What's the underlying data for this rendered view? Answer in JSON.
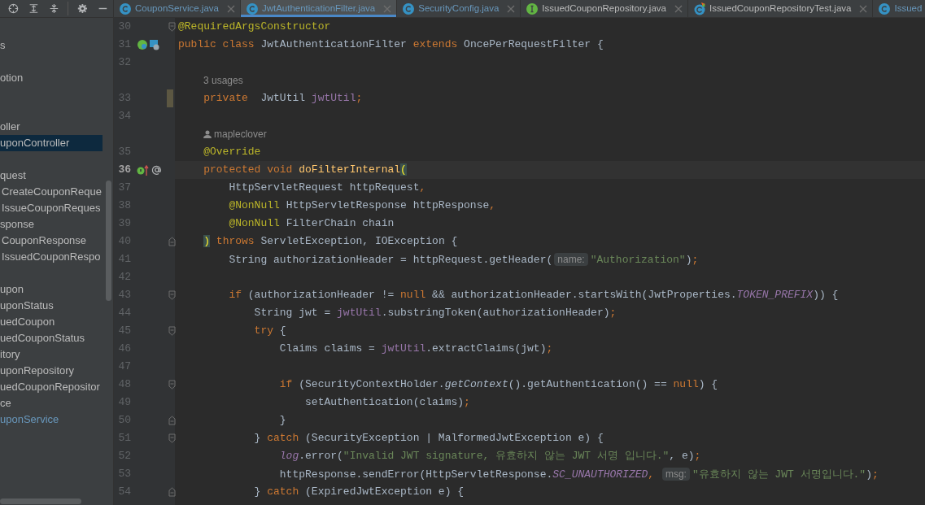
{
  "toolbar": {
    "icons": [
      {
        "kind": "locate"
      },
      {
        "kind": "expand"
      },
      {
        "kind": "collapse"
      },
      {
        "kind": "divider"
      },
      {
        "kind": "settings"
      },
      {
        "kind": "hide"
      }
    ]
  },
  "tabs": [
    {
      "label": "CouponService.java",
      "icon": {
        "kind": "class"
      },
      "selected": false,
      "closable": true
    },
    {
      "label": "JwtAuthenticationFilter.java",
      "icon": {
        "kind": "class"
      },
      "selected": true,
      "closable": true
    },
    {
      "label": "SecurityConfig.java",
      "icon": {
        "kind": "class"
      },
      "selected": false,
      "closable": true
    },
    {
      "label": "IssuedCouponRepository.java",
      "icon": {
        "kind": "interface"
      },
      "selected": false,
      "closable": true
    },
    {
      "label": "IssuedCouponRepositoryTest.java",
      "icon": {
        "kind": "test"
      },
      "selected": false,
      "closable": true
    },
    {
      "label": "Issued",
      "icon": {
        "kind": "class"
      },
      "selected": false,
      "closable": false
    }
  ],
  "sidebar": {
    "items": [
      {
        "kind": "blank"
      },
      {
        "kind": "item",
        "text": "s",
        "selected": false,
        "modified": false
      },
      {
        "kind": "blank"
      },
      {
        "kind": "item",
        "text": "otion",
        "selected": false,
        "modified": false
      },
      {
        "kind": "blank"
      },
      {
        "kind": "blank"
      },
      {
        "kind": "item",
        "text": "oller",
        "selected": false,
        "modified": false
      },
      {
        "kind": "item",
        "text": "uponController",
        "selected": true,
        "modified": false
      },
      {
        "kind": "blank"
      },
      {
        "kind": "item",
        "text": "quest",
        "selected": false,
        "modified": false
      },
      {
        "kind": "nested",
        "text": "CreateCouponReque",
        "selected": false,
        "modified": false
      },
      {
        "kind": "nested",
        "text": "IssueCouponReques",
        "selected": false,
        "modified": false
      },
      {
        "kind": "item",
        "text": "sponse",
        "selected": false,
        "modified": false
      },
      {
        "kind": "nested",
        "text": "CouponResponse",
        "selected": false,
        "modified": false
      },
      {
        "kind": "nested",
        "text": "IssuedCouponRespo",
        "selected": false,
        "modified": false
      },
      {
        "kind": "blank"
      },
      {
        "kind": "item",
        "text": "upon",
        "selected": false,
        "modified": false
      },
      {
        "kind": "item",
        "text": "uponStatus",
        "selected": false,
        "modified": false
      },
      {
        "kind": "item",
        "text": "uedCoupon",
        "selected": false,
        "modified": false
      },
      {
        "kind": "item",
        "text": "uedCouponStatus",
        "selected": false,
        "modified": false
      },
      {
        "kind": "item",
        "text": "itory",
        "selected": false,
        "modified": false
      },
      {
        "kind": "item",
        "text": "uponRepository",
        "selected": false,
        "modified": false
      },
      {
        "kind": "item",
        "text": "uedCouponRepositor",
        "selected": false,
        "modified": false
      },
      {
        "kind": "item",
        "text": "ce",
        "selected": false,
        "modified": false
      },
      {
        "kind": "item",
        "text": "uponService",
        "selected": false,
        "modified": true
      }
    ]
  },
  "editor": {
    "lines": [
      {
        "kind": "code",
        "number": "30",
        "fold_start": true,
        "tokens": [
          {
            "kind": "ann",
            "text": "@RequiredArgsConstructor"
          }
        ]
      },
      {
        "kind": "code",
        "number": "31",
        "gutter": {
          "kind": "bean"
        },
        "tokens": [
          {
            "kind": "kw",
            "text": "public class "
          },
          {
            "kind": "plain",
            "text": "JwtAuthenticationFilter "
          },
          {
            "kind": "kw",
            "text": "extends "
          },
          {
            "kind": "plain",
            "text": "OncePerRequestFilter {"
          }
        ]
      },
      {
        "kind": "code",
        "number": "32"
      },
      {
        "kind": "usages",
        "text": "3 usages"
      },
      {
        "kind": "code",
        "number": "33",
        "changed": true,
        "tokens": [
          {
            "kind": "kw",
            "text": "    private"
          },
          {
            "kind": "plain",
            "text": "  JwtUtil "
          },
          {
            "kind": "field",
            "text": "jwtUtil"
          },
          {
            "kind": "kw",
            "text": ";"
          }
        ]
      },
      {
        "kind": "code",
        "number": "34"
      },
      {
        "kind": "author",
        "text": "mapleclover"
      },
      {
        "kind": "code",
        "number": "35",
        "tokens": [
          {
            "kind": "ann",
            "text": "    @Override"
          }
        ]
      },
      {
        "kind": "code",
        "number": "36",
        "current": true,
        "gutter": {
          "kind": "override"
        },
        "tokens": [
          {
            "kind": "kw",
            "text": "    protected void "
          },
          {
            "kind": "decl",
            "text": "doFilterInternal"
          },
          {
            "kind": "match",
            "text": "("
          }
        ]
      },
      {
        "kind": "code",
        "number": "37",
        "tokens": [
          {
            "kind": "plain",
            "text": "        HttpServletRequest httpRequest"
          },
          {
            "kind": "kw",
            "text": ","
          }
        ]
      },
      {
        "kind": "code",
        "number": "38",
        "tokens": [
          {
            "kind": "ann",
            "text": "        @NonNull"
          },
          {
            "kind": "plain",
            "text": " HttpServletResponse httpResponse"
          },
          {
            "kind": "kw",
            "text": ","
          }
        ]
      },
      {
        "kind": "code",
        "number": "39",
        "tokens": [
          {
            "kind": "ann",
            "text": "        @NonNull"
          },
          {
            "kind": "plain",
            "text": " FilterChain chain"
          }
        ]
      },
      {
        "kind": "code",
        "number": "40",
        "fold_end": true,
        "tokens": [
          {
            "kind": "match",
            "text": "    )"
          },
          {
            "kind": "kw",
            "text": " throws "
          },
          {
            "kind": "plain",
            "text": "ServletException, IOException {"
          }
        ]
      },
      {
        "kind": "code",
        "number": "41",
        "tokens": [
          {
            "kind": "plain",
            "text": "        String authorizationHeader = httpRequest.getHeader("
          },
          {
            "kind": "hint",
            "text": "name:"
          },
          {
            "kind": "str",
            "text": "\"Authorization\""
          },
          {
            "kind": "plain",
            "text": ")"
          },
          {
            "kind": "kw",
            "text": ";"
          }
        ]
      },
      {
        "kind": "code",
        "number": "42"
      },
      {
        "kind": "code",
        "number": "43",
        "fold_start": true,
        "tokens": [
          {
            "kind": "kw",
            "text": "        if"
          },
          {
            "kind": "plain",
            "text": " (authorizationHeader != "
          },
          {
            "kind": "kw",
            "text": "null"
          },
          {
            "kind": "plain",
            "text": " && authorizationHeader.startsWith(JwtProperties."
          },
          {
            "kind": "static",
            "text": "TOKEN_PREFIX"
          },
          {
            "kind": "plain",
            "text": ")) {"
          }
        ]
      },
      {
        "kind": "code",
        "number": "44",
        "tokens": [
          {
            "kind": "plain",
            "text": "            String jwt = "
          },
          {
            "kind": "field",
            "text": "jwtUtil"
          },
          {
            "kind": "plain",
            "text": ".substringToken(authorizationHeader)"
          },
          {
            "kind": "kw",
            "text": ";"
          }
        ]
      },
      {
        "kind": "code",
        "number": "45",
        "fold_start": true,
        "tokens": [
          {
            "kind": "kw",
            "text": "            try"
          },
          {
            "kind": "plain",
            "text": " {"
          }
        ]
      },
      {
        "kind": "code",
        "number": "46",
        "tokens": [
          {
            "kind": "plain",
            "text": "                Claims claims = "
          },
          {
            "kind": "field",
            "text": "jwtUtil"
          },
          {
            "kind": "plain",
            "text": ".extractClaims(jwt)"
          },
          {
            "kind": "kw",
            "text": ";"
          }
        ]
      },
      {
        "kind": "code",
        "number": "47"
      },
      {
        "kind": "code",
        "number": "48",
        "fold_start": true,
        "tokens": [
          {
            "kind": "kw",
            "text": "                if"
          },
          {
            "kind": "plain",
            "text": " (SecurityContextHolder."
          },
          {
            "kind": "italic",
            "text": "getContext"
          },
          {
            "kind": "plain",
            "text": "().getAuthentication() == "
          },
          {
            "kind": "kw",
            "text": "null"
          },
          {
            "kind": "plain",
            "text": ") {"
          }
        ]
      },
      {
        "kind": "code",
        "number": "49",
        "tokens": [
          {
            "kind": "plain",
            "text": "                    setAuthentication(claims)"
          },
          {
            "kind": "kw",
            "text": ";"
          }
        ]
      },
      {
        "kind": "code",
        "number": "50",
        "fold_end": true,
        "tokens": [
          {
            "kind": "plain",
            "text": "                }"
          }
        ]
      },
      {
        "kind": "code",
        "number": "51",
        "fold_start": true,
        "tokens": [
          {
            "kind": "plain",
            "text": "            } "
          },
          {
            "kind": "kw",
            "text": "catch"
          },
          {
            "kind": "plain",
            "text": " (SecurityException | MalformedJwtException e) {"
          }
        ]
      },
      {
        "kind": "code",
        "number": "52",
        "tokens": [
          {
            "kind": "static",
            "text": "                log"
          },
          {
            "kind": "plain",
            "text": ".error("
          },
          {
            "kind": "str",
            "text": "\"Invalid JWT signature, 유효하지 않는 JWT 서명 입니다.\""
          },
          {
            "kind": "plain",
            "text": ", e)"
          },
          {
            "kind": "kw",
            "text": ";"
          }
        ]
      },
      {
        "kind": "code",
        "number": "53",
        "tokens": [
          {
            "kind": "plain",
            "text": "                httpResponse.sendError(HttpServletResponse."
          },
          {
            "kind": "static",
            "text": "SC_UNAUTHORIZED"
          },
          {
            "kind": "kw",
            "text": ", "
          },
          {
            "kind": "hint",
            "text": "msg:"
          },
          {
            "kind": "str",
            "text": "\"유효하지 않는 JWT 서명입니다.\""
          },
          {
            "kind": "plain",
            "text": ")"
          },
          {
            "kind": "kw",
            "text": ";"
          }
        ]
      },
      {
        "kind": "code",
        "number": "54",
        "fold_end": true,
        "tokens": [
          {
            "kind": "plain",
            "text": "            } "
          },
          {
            "kind": "kw",
            "text": "catch"
          },
          {
            "kind": "plain",
            "text": " (ExpiredJwtException e) {"
          }
        ]
      }
    ]
  }
}
